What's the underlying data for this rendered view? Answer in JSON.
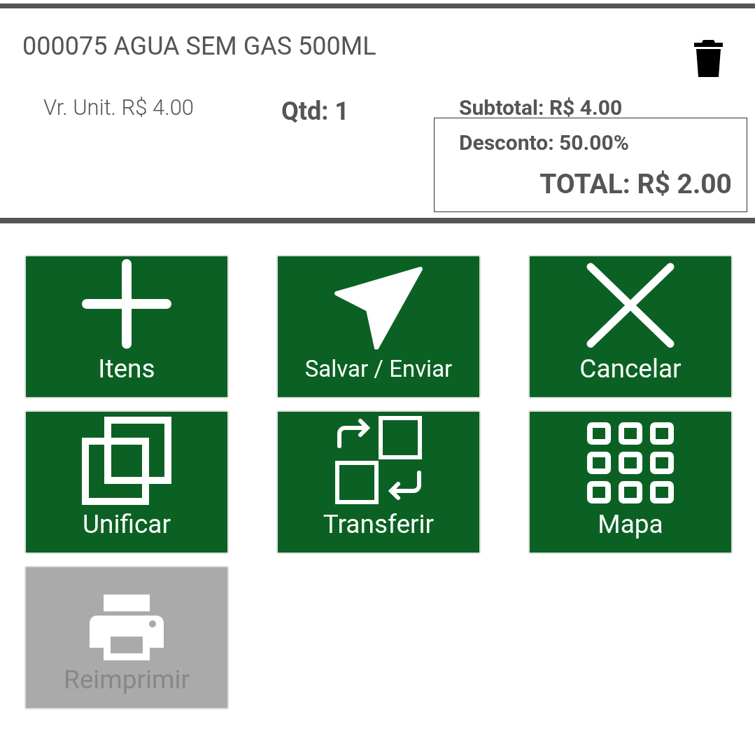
{
  "item": {
    "title": "000075 AGUA SEM GAS 500ML",
    "unit_price": "Vr. Unit. R$ 4.00",
    "quantity": "Qtd: 1",
    "subtotal": "Subtotal: R$ 4.00",
    "discount": "Desconto: 50.00%",
    "total": "TOTAL: R$ 2.00"
  },
  "actions": [
    {
      "label": "Itens",
      "disabled": false
    },
    {
      "label": "Salvar / Enviar",
      "disabled": false
    },
    {
      "label": "Cancelar",
      "disabled": false
    },
    {
      "label": "Unificar",
      "disabled": false
    },
    {
      "label": "Transferir",
      "disabled": false
    },
    {
      "label": "Mapa",
      "disabled": false
    },
    {
      "label": "Reimprimir",
      "disabled": true
    }
  ]
}
